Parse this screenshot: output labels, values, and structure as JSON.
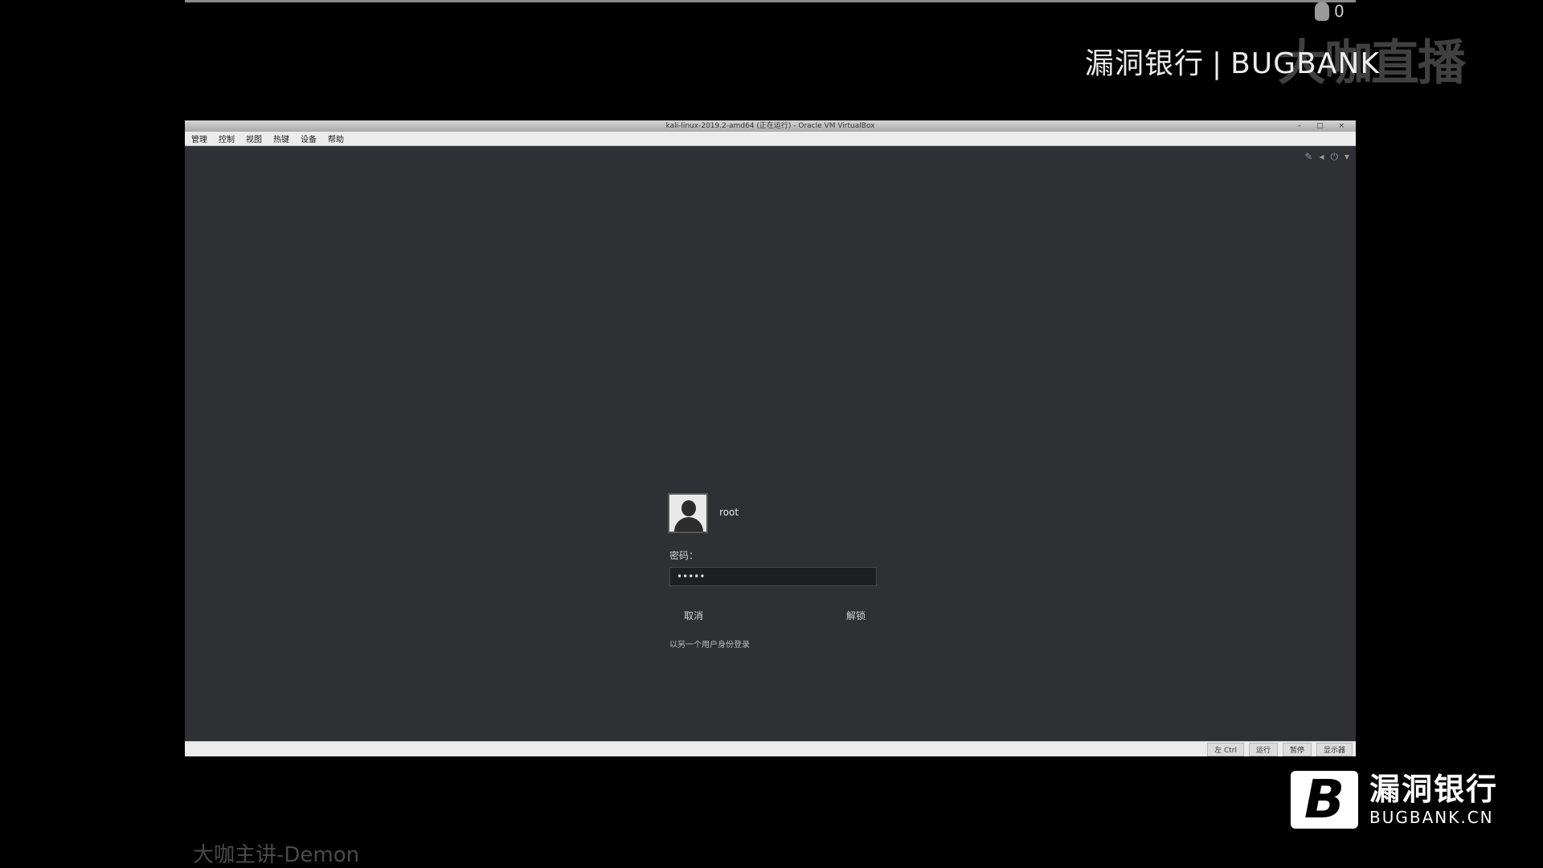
{
  "watermark": {
    "top_cn": "漏洞银行",
    "separator": "|",
    "top_en": "BUGBANK",
    "overlay": "大咖直播",
    "likes_count": "0",
    "author": "大咖主讲-Demon"
  },
  "vm": {
    "title": "kali-linux-2019.2-amd64 (正在运行) - Oracle VM VirtualBox",
    "menu": [
      "管理",
      "控制",
      "视图",
      "热键",
      "设备",
      "帮助"
    ],
    "status_items": [
      "左 Ctrl",
      "运行",
      "暂停",
      "显示器"
    ]
  },
  "lock_screen": {
    "username": "root",
    "password_label": "密码：",
    "password_value": "•••••",
    "cancel_label": "取消",
    "unlock_label": "解锁",
    "other_user_link": "以另一个用户身份登录"
  },
  "brand": {
    "logo_letter": "B",
    "name_cn": "漏洞银行",
    "name_en": "BUGBANK.CN"
  }
}
